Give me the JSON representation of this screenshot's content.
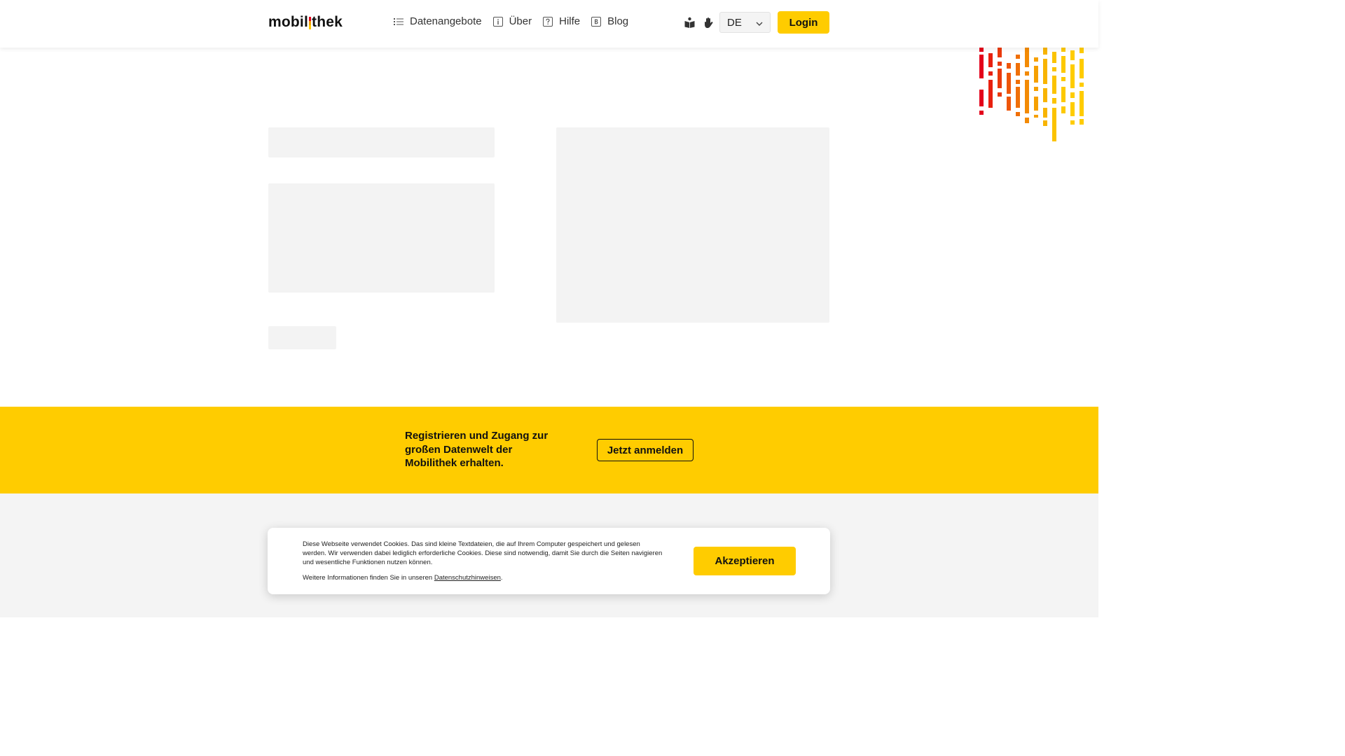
{
  "header": {
    "logo": {
      "before": "mobil",
      "after": "thek"
    },
    "nav": [
      {
        "label": "Datenangebote",
        "icon": "list-icon"
      },
      {
        "label": "Über",
        "icon": "info-icon"
      },
      {
        "label": "Hilfe",
        "icon": "help-icon"
      },
      {
        "label": "Blog",
        "icon": "blog-icon"
      }
    ],
    "tools": [
      {
        "icon": "easy-read-icon"
      },
      {
        "icon": "sign-language-icon"
      }
    ],
    "language": "DE",
    "login_label": "Login"
  },
  "banner": {
    "text": "Registrieren und Zugang zur großen Datenwelt der Mobilithek erhalten.",
    "button_label": "Jetzt anmelden"
  },
  "cookie": {
    "text": "Diese Webseite verwendet Cookies. Das sind kleine Textdateien, die auf Ihrem Computer gespeichert und gelesen werden. Wir verwenden dabei lediglich erforderliche Cookies. Diese sind notwendig, damit Sie durch die Seiten navigieren und wesentliche Funktionen nutzen können.",
    "more_prefix": "Weitere Informationen finden Sie in unseren",
    "more_link": "Datenschutzhinweisen",
    "more_suffix": ".",
    "accept_label": "Akzeptieren"
  },
  "colors": {
    "brand_yellow": "#ffcc00",
    "accent_red": "#e3001b",
    "accent_orange": "#f6a000"
  }
}
